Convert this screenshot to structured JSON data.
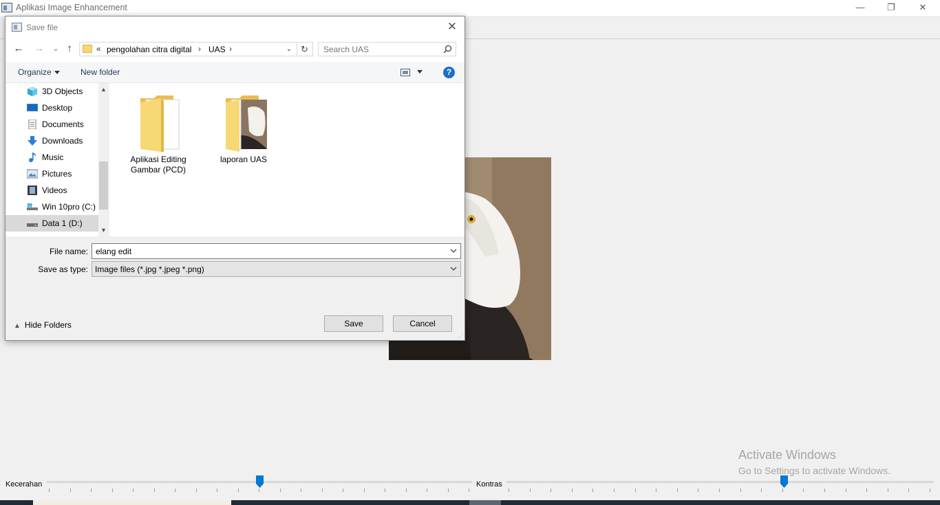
{
  "app": {
    "title": "Aplikasi Image Enhancement",
    "minimize": "—",
    "restore": "❐",
    "close": "✕"
  },
  "sliders": [
    {
      "label": "Kecerahan",
      "value_fraction": 0.5
    },
    {
      "label": "Kontras",
      "value_fraction": 0.65
    }
  ],
  "watermark": {
    "title": "Activate Windows",
    "subtitle": "Go to Settings to activate Windows."
  },
  "dialog": {
    "title": "Save file",
    "close": "✕",
    "nav": {
      "back": "←",
      "forward": "→",
      "recent": "⌄",
      "up": "↑"
    },
    "address": {
      "overflow": "«",
      "crumbs": [
        "pengolahan citra digital",
        "UAS"
      ],
      "separator": "›",
      "dropdown": "⌄",
      "refresh": "↻"
    },
    "search": {
      "placeholder": "Search UAS"
    },
    "toolbar": {
      "organize": "Organize",
      "new_folder": "New folder",
      "help": "?"
    },
    "nav_pane": [
      {
        "label": "3D Objects",
        "icon": "3d-objects-icon",
        "selected": false
      },
      {
        "label": "Desktop",
        "icon": "desktop-icon",
        "selected": false
      },
      {
        "label": "Documents",
        "icon": "documents-icon",
        "selected": false
      },
      {
        "label": "Downloads",
        "icon": "downloads-icon",
        "selected": false
      },
      {
        "label": "Music",
        "icon": "music-icon",
        "selected": false
      },
      {
        "label": "Pictures",
        "icon": "pictures-icon",
        "selected": false
      },
      {
        "label": "Videos",
        "icon": "videos-icon",
        "selected": false
      },
      {
        "label": "Win 10pro (C:)",
        "icon": "drive-c-icon",
        "selected": false
      },
      {
        "label": "Data 1 (D:)",
        "icon": "drive-d-icon",
        "selected": true
      }
    ],
    "scroll": {
      "up": "▲",
      "down": "▼"
    },
    "folders": [
      {
        "label": "Aplikasi Editing Gambar (PCD)"
      },
      {
        "label": "laporan UAS"
      }
    ],
    "file_name": {
      "label": "File name:",
      "value": "elang edit"
    },
    "save_as_type": {
      "label": "Save as type:",
      "value": "Image files (*.jpg *.jpeg *.png)"
    },
    "hide_folders": "Hide Folders",
    "save_button": "Save",
    "cancel_button": "Cancel"
  },
  "colors": {
    "accent": "#0078d7",
    "folder": "#f8d775",
    "help": "#1a6fc7"
  }
}
